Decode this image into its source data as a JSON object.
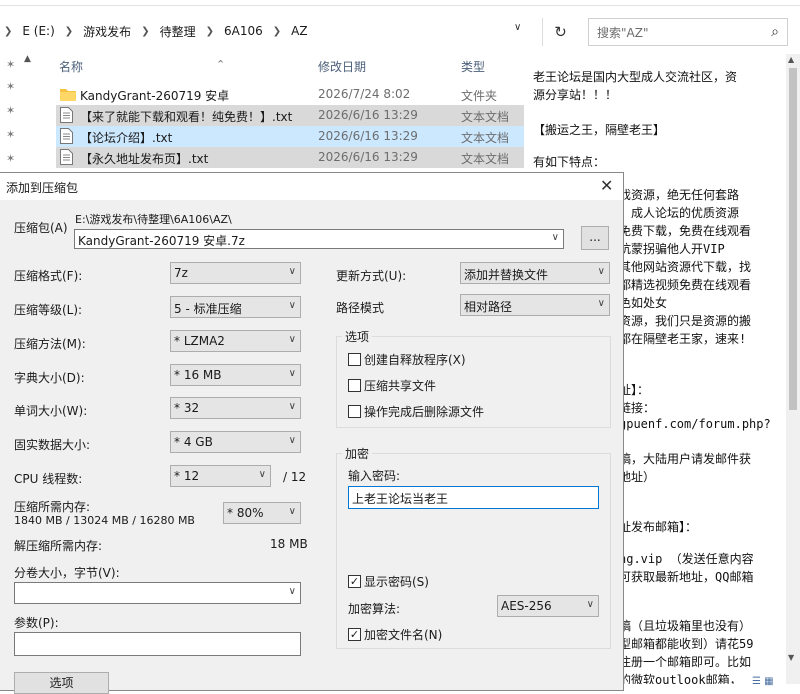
{
  "explorer": {
    "breadcrumb": [
      "E (E:)",
      "游戏发布",
      "待整理",
      "6A106",
      "AZ"
    ],
    "search_placeholder": "搜索\"AZ\"",
    "columns": {
      "name": "名称",
      "date": "修改日期",
      "type": "类型"
    },
    "files": [
      {
        "name": "KandyGrant-260719 安卓",
        "date": "2026/7/24 8:02",
        "type": "文件夹",
        "kind": "folder"
      },
      {
        "name": "【来了就能下载和观看！纯免费！】.txt",
        "date": "2026/6/16 13:29",
        "type": "文本文档",
        "kind": "txt"
      },
      {
        "name": "【论坛介绍】.txt",
        "date": "2026/6/16 13:29",
        "type": "文本文档",
        "kind": "txt"
      },
      {
        "name": "【永久地址发布页】.txt",
        "date": "2026/6/16 13:29",
        "type": "文本文档",
        "kind": "txt"
      }
    ],
    "preview_lines": [
      "老王论坛是国内大型成人交流社区，资",
      "源分享站！！！",
      "【搬运之王，隔壁老王】",
      "有如下特点：",
      "戏资源，绝无任何套路",
      "，成人论坛的优质资源",
      "免费下载，免费在线观看",
      "坑蒙拐骗他人开VIP",
      "其他网站资源代下载，找",
      "都精选视频免费在线观看",
      "色如处女",
      "资源，我们只是资源的搬",
      "都在隔壁老王家，速来!",
      "址】：",
      "链接：",
      "gpuenf.com/forum.php?",
      "稿，大陆用户请发邮件获",
      "地址）",
      "址发布邮箱】：",
      "ng.vip  （发送任意内容",
      "可获取最新地址，QQ邮箱",
      "稿（且垃圾箱里也没有）",
      "型邮箱都能收到）请花59",
      "注册一个邮箱即可。比如",
      "的微软outlook邮箱，"
    ]
  },
  "dialog": {
    "title": "添加到压缩包",
    "archive_label": "压缩包(A)",
    "archive_path": "E:\\游戏发布\\待整理\\6A106\\AZ\\",
    "archive_name": "KandyGrant-260719 安卓.7z",
    "browse_label": "...",
    "format_label": "压缩格式(F):",
    "format_value": "7z",
    "level_label": "压缩等级(L):",
    "level_value": "5 - 标准压缩",
    "method_label": "压缩方法(M):",
    "method_value": "* LZMA2",
    "dict_label": "字典大小(D):",
    "dict_value": "* 16 MB",
    "word_label": "单词大小(W):",
    "word_value": "* 32",
    "solid_label": "固实数据大小:",
    "solid_value": "* 4 GB",
    "threads_label": "CPU 线程数:",
    "threads_value": "* 12",
    "threads_total": "/ 12",
    "mem_label": "压缩所需内存:",
    "mem_values": "1840 MB / 13024 MB / 16280 MB",
    "mem_percent": "* 80%",
    "decomp_label": "解压缩所需内存:",
    "decomp_value": "18 MB",
    "split_label": "分卷大小，字节(V):",
    "split_value": "",
    "params_label": "参数(P):",
    "params_value": "",
    "options_button": "选项",
    "update_label": "更新方式(U):",
    "update_value": "添加并替换文件",
    "path_label": "路径模式",
    "path_value": "相对路径",
    "options_group": "选项",
    "opt_sfx": "创建自释放程序(X)",
    "opt_shared": "压缩共享文件",
    "opt_delete": "操作完成后删除源文件",
    "encrypt_group": "加密",
    "password_label": "输入密码:",
    "password_value": "上老王论坛当老王",
    "show_password": "显示密码(S)",
    "enc_method_label": "加密算法:",
    "enc_method_value": "AES-256",
    "encrypt_names": "加密文件名(N)"
  }
}
